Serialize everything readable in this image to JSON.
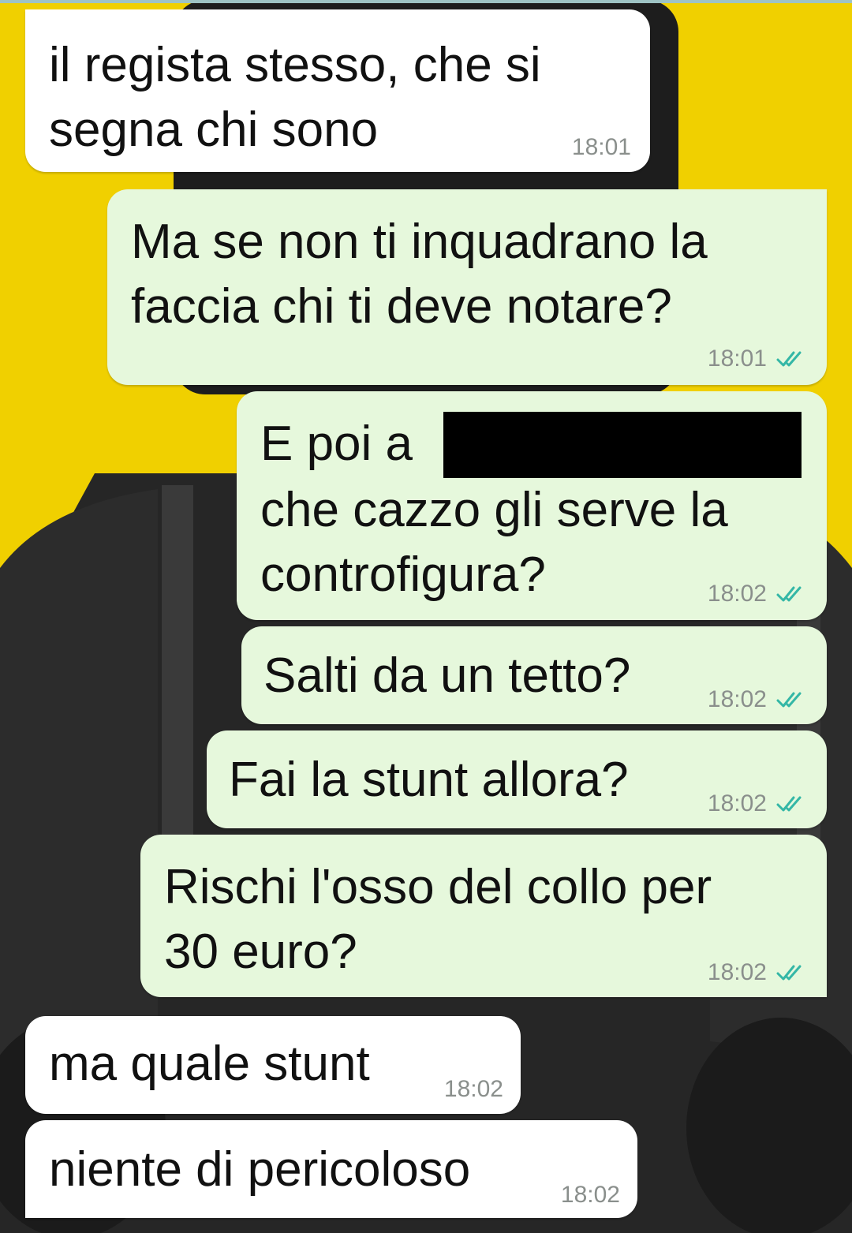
{
  "chat": {
    "messages": [
      {
        "direction": "in",
        "text": "il regista stesso, che si\nsegna chi sono",
        "time": "18:01"
      },
      {
        "direction": "out",
        "text": "Ma se non ti inquadrano la\nfaccia chi ti deve notare?",
        "time": "18:01",
        "read_receipt": "double-check-icon"
      },
      {
        "direction": "out",
        "text_before_redaction": "E poi a",
        "text_after_redaction": "che cazzo gli serve la\ncontrofigura?",
        "time": "18:02",
        "read_receipt": "double-check-icon"
      },
      {
        "direction": "out",
        "text": "Salti da un tetto?",
        "time": "18:02",
        "read_receipt": "double-check-icon"
      },
      {
        "direction": "out",
        "text": "Fai la stunt allora?",
        "time": "18:02",
        "read_receipt": "double-check-icon"
      },
      {
        "direction": "out",
        "text": "Rischi l'osso del collo per\n30 euro?",
        "time": "18:02",
        "read_receipt": "double-check-icon"
      },
      {
        "direction": "in",
        "text": "ma quale stunt",
        "time": "18:02"
      },
      {
        "direction": "in",
        "text": "niente di pericoloso",
        "time": "18:02"
      }
    ]
  },
  "colors": {
    "wallpaper_yellow": "#f0d000",
    "wallpaper_figure": "#1f1f1f",
    "incoming_bubble": "#ffffff",
    "outgoing_bubble": "#e6f8dc",
    "read_tick": "#34b7a6",
    "timestamp": "#8a8f8c"
  }
}
